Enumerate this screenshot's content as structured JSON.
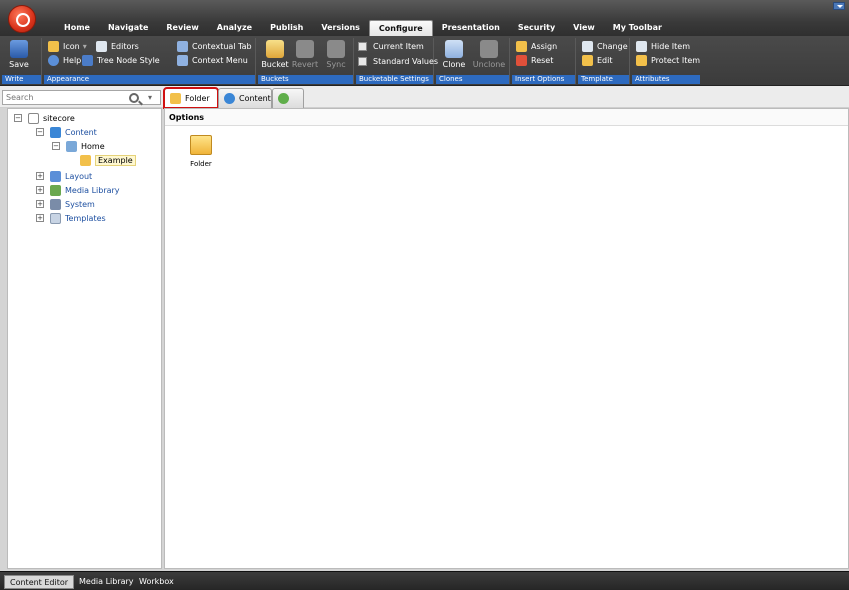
{
  "menu": {
    "items": [
      "Home",
      "Navigate",
      "Review",
      "Analyze",
      "Publish",
      "Versions",
      "Configure",
      "Presentation",
      "Security",
      "View",
      "My Toolbar"
    ],
    "active": "Configure"
  },
  "ribbon": {
    "write": {
      "save_label": "Save",
      "caption": "Write"
    },
    "appearance": {
      "icon_label": "Icon",
      "help_label": "Help",
      "editors_label": "Editors",
      "tree_node_style_label": "Tree Node Style",
      "contextual_tab_label": "Contextual Tab",
      "context_menu_label": "Context Menu",
      "caption": "Appearance"
    },
    "buckets": {
      "bucket_label": "Bucket",
      "revert_label": "Revert",
      "sync_label": "Sync",
      "caption": "Buckets"
    },
    "bucketable": {
      "current_item_label": "Current Item",
      "standard_values_label": "Standard Values",
      "caption": "Bucketable Settings"
    },
    "clones": {
      "clone_label": "Clone",
      "unclone_label": "Unclone",
      "caption": "Clones"
    },
    "insert_options": {
      "assign_label": "Assign",
      "reset_label": "Reset",
      "caption": "Insert Options"
    },
    "template": {
      "change_label": "Change",
      "edit_label": "Edit",
      "caption": "Template"
    },
    "attributes": {
      "hide_item_label": "Hide Item",
      "protect_item_label": "Protect Item",
      "caption": "Attributes"
    }
  },
  "search": {
    "placeholder": "Search"
  },
  "tabs": {
    "folder": "Folder",
    "content": "Content"
  },
  "tree": {
    "sitecore": "sitecore",
    "content": "Content",
    "home": "Home",
    "example": "Example",
    "layout": "Layout",
    "media_library": "Media Library",
    "system": "System",
    "templates": "Templates"
  },
  "options": {
    "header": "Options",
    "folder_label": "Folder"
  },
  "bottom": {
    "content_editor": "Content Editor",
    "media_library": "Media Library",
    "workbox": "Workbox"
  },
  "colors": {
    "ribbon_caption": "#2d6abf",
    "highlight": "#d01010"
  }
}
